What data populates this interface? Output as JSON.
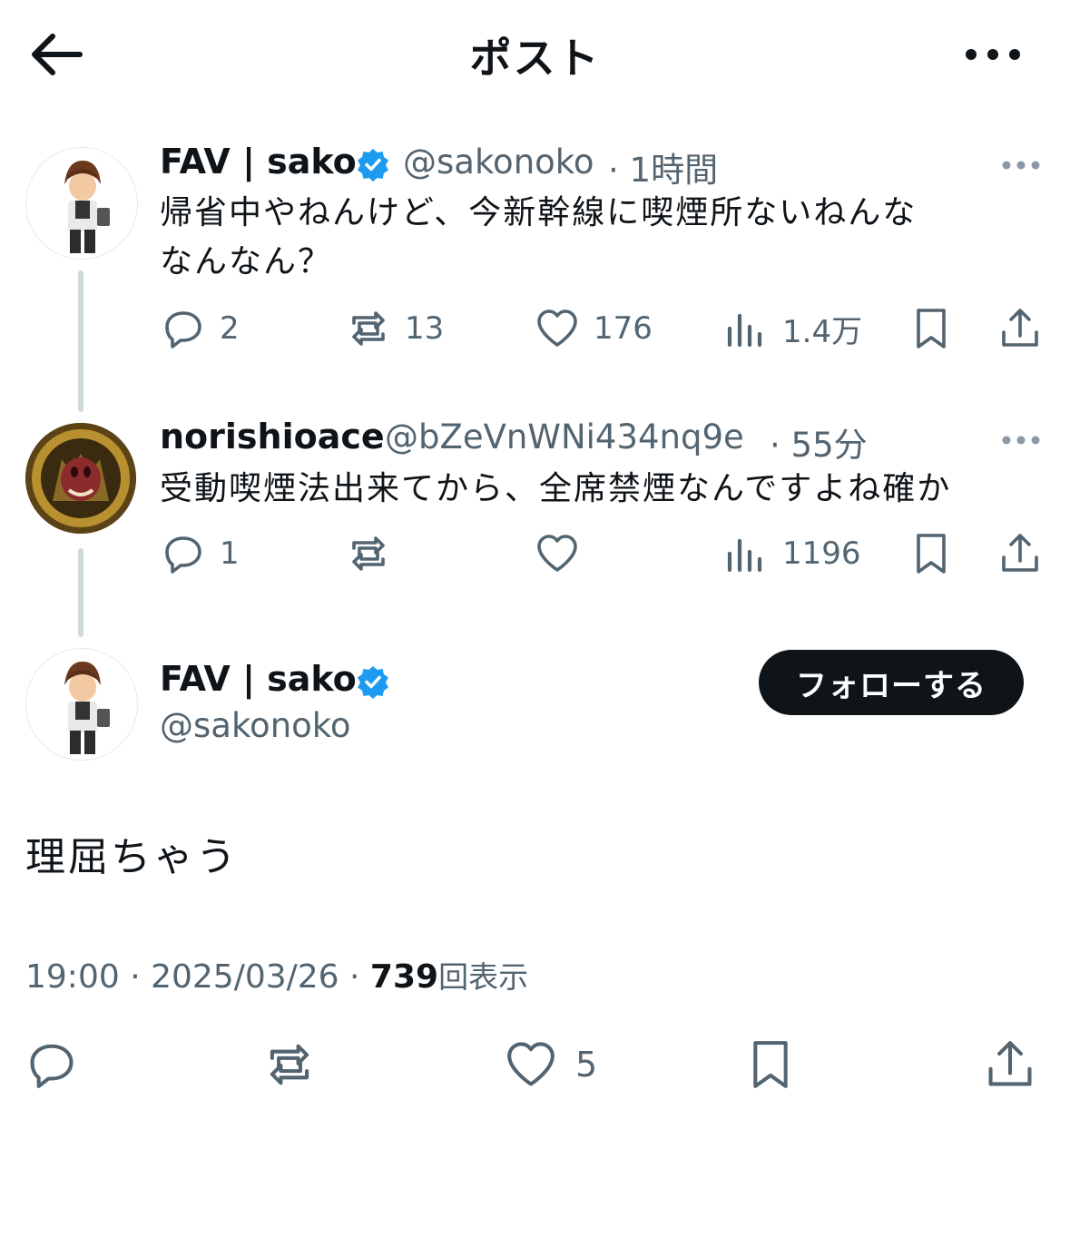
{
  "header": {
    "title": "ポスト"
  },
  "thread": [
    {
      "name": "FAV | sako",
      "handle": "@sakonoko",
      "time": "· 1時間",
      "text_line1": "帰省中やねんけど、今新幹線に喫煙所ないねんな",
      "text_line2": "なんなん？",
      "replies": "2",
      "reposts": "13",
      "likes": "176",
      "views": "1.4万"
    },
    {
      "name": "norishioace",
      "handle": "@bZeVnWNi434nq9e",
      "time": "· 55分",
      "text": "受動喫煙法出来てから、全席禁煙なんですよね確か",
      "replies": "1",
      "reposts": "",
      "likes": "",
      "views": "1196"
    }
  ],
  "main_post": {
    "name": "FAV | sako",
    "handle": "@sakonoko",
    "follow_label": "フォローする",
    "text": "理屈ちゃう",
    "timestamp": "19:00 · 2025/03/26 · ",
    "view_count": "739",
    "view_label": "回表示",
    "likes": "5"
  },
  "colors": {
    "verified": "#1d9bf0",
    "muted": "#536471",
    "text": "#0f1419"
  }
}
